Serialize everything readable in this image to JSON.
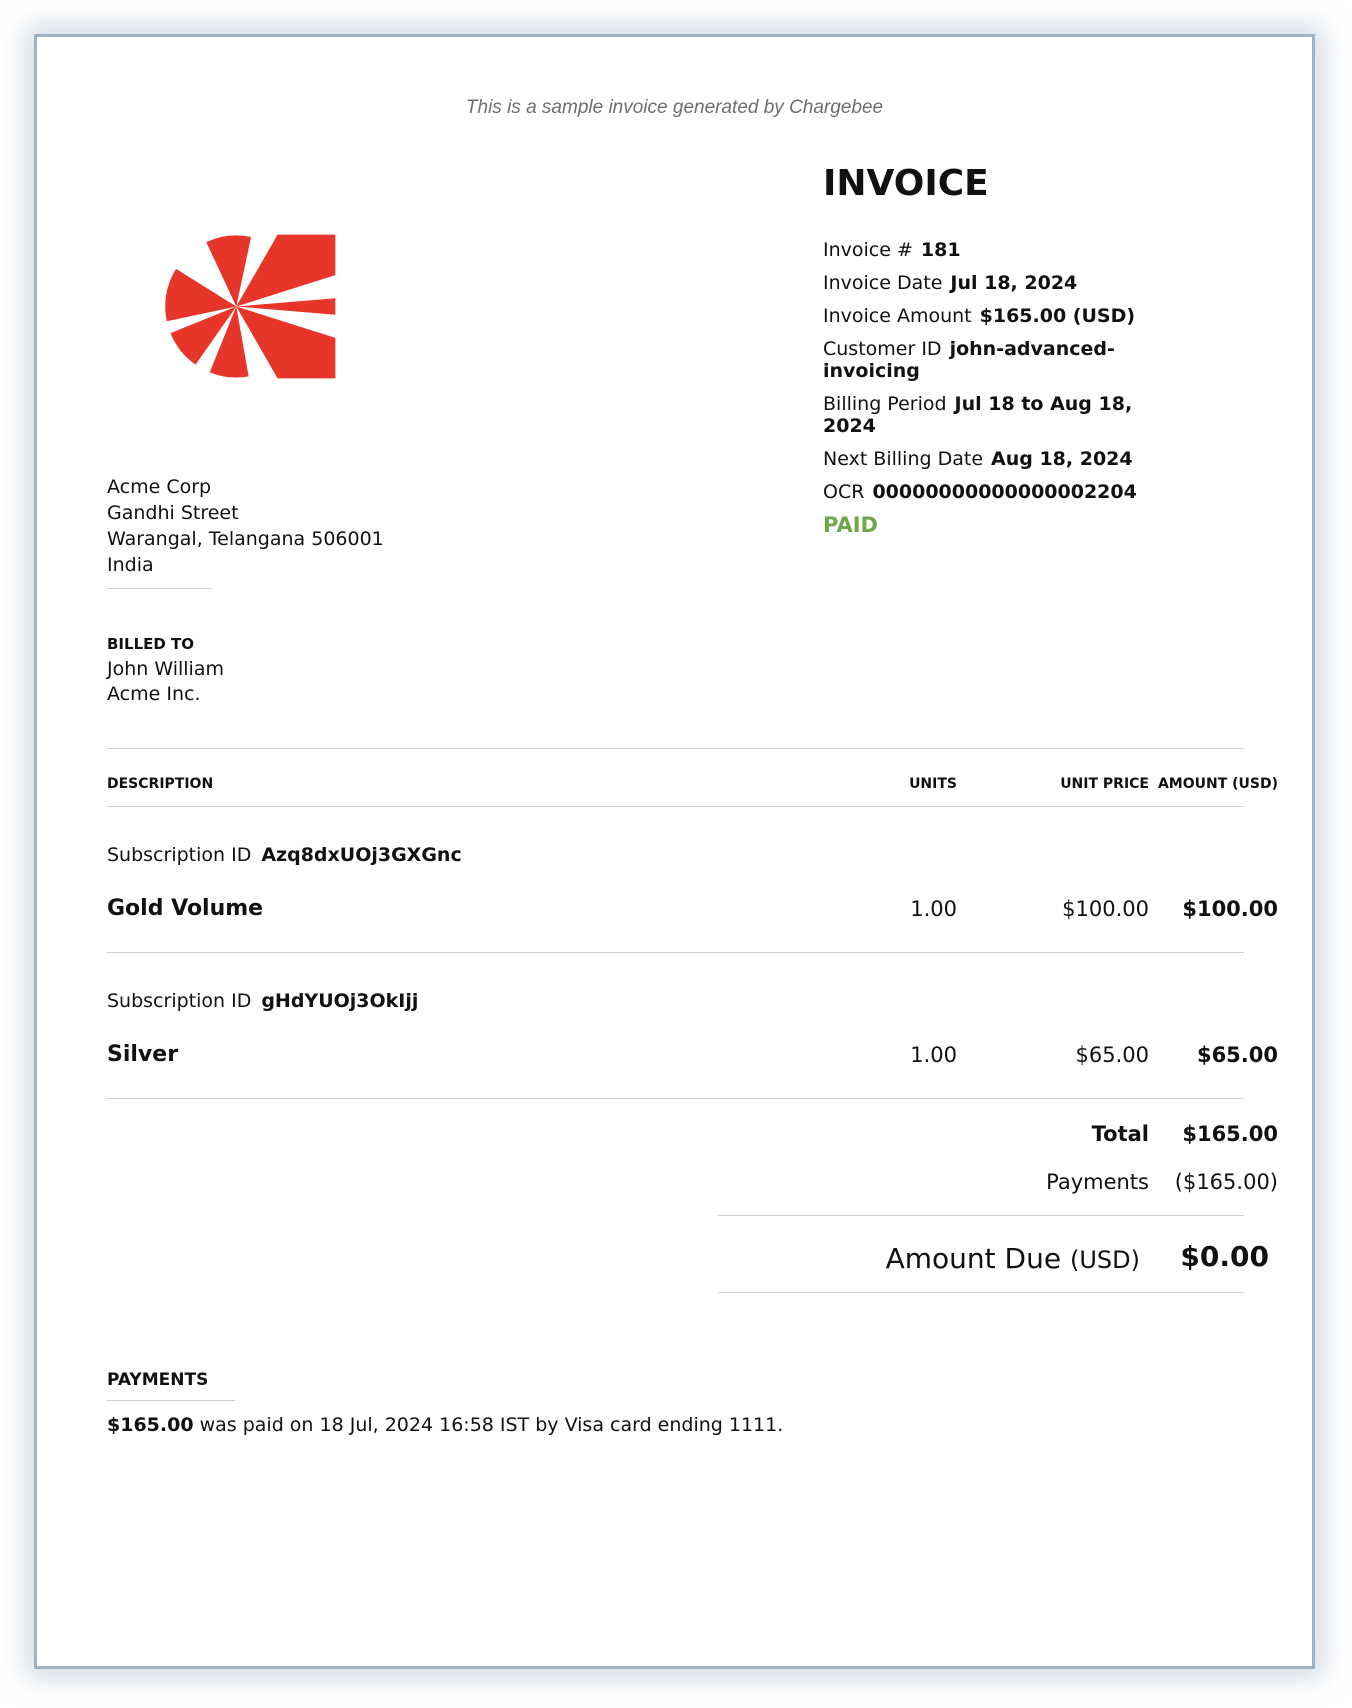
{
  "sample_note": "This is a sample invoice generated by Chargebee",
  "logo": {
    "icon": "pinwheel-logo-icon",
    "color": "#e8352a"
  },
  "invoice": {
    "title": "INVOICE",
    "number_label": "Invoice #",
    "number": "181",
    "date_label": "Invoice Date",
    "date": "Jul 18, 2024",
    "amount_label": "Invoice Amount",
    "amount": "$165.00 (USD)",
    "customer_label": "Customer ID",
    "customer_id": "john-advanced-invoicing",
    "period_label": "Billing Period",
    "period": "Jul 18 to Aug 18, 2024",
    "next_label": "Next Billing Date",
    "next_date": "Aug 18, 2024",
    "ocr_label": "OCR",
    "ocr": "00000000000000002204",
    "status": "PAID",
    "status_color": "#6fa84a"
  },
  "seller": {
    "name": "Acme Corp",
    "street": "Gandhi Street",
    "city": "Warangal, Telangana 506001",
    "country": "India"
  },
  "billed_to": {
    "label": "BILLED TO",
    "name": "John William",
    "company": "Acme Inc."
  },
  "table": {
    "headers": {
      "description": "DESCRIPTION",
      "units": "UNITS",
      "unit_price": "UNIT PRICE",
      "amount": "AMOUNT (USD)"
    },
    "groups": [
      {
        "sub_label": "Subscription ID",
        "sub_id": "Azq8dxUOj3GXGnc",
        "name": "Gold Volume",
        "units": "1.00",
        "unit_price": "$100.00",
        "amount": "$100.00"
      },
      {
        "sub_label": "Subscription ID",
        "sub_id": "gHdYUOj3OkIjj",
        "name": "Silver",
        "units": "1.00",
        "unit_price": "$65.00",
        "amount": "$65.00"
      }
    ]
  },
  "totals": {
    "total_label": "Total",
    "total": "$165.00",
    "payments_label": "Payments",
    "payments": "($165.00)",
    "due_label": "Amount Due",
    "due_unit": "(USD)",
    "due": "$0.00"
  },
  "payments": {
    "heading": "PAYMENTS",
    "amount": "$165.00",
    "text": "was paid on 18 Jul, 2024 16:58 IST by Visa card ending 1111."
  }
}
